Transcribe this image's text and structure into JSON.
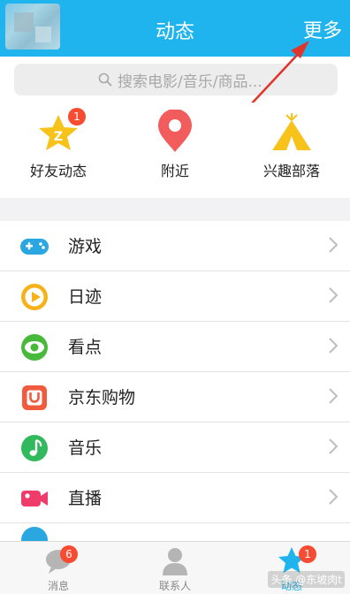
{
  "header": {
    "title": "动态",
    "more_label": "更多"
  },
  "search": {
    "placeholder": "搜索电影/音乐/商品..."
  },
  "shortcuts": [
    {
      "label": "好友动态",
      "icon": "qzone-star-icon",
      "badge": "1"
    },
    {
      "label": "附近",
      "icon": "location-pin-icon"
    },
    {
      "label": "兴趣部落",
      "icon": "tent-icon"
    }
  ],
  "list": [
    {
      "label": "游戏",
      "icon": "gamepad-icon"
    },
    {
      "label": "日迹",
      "icon": "play-circle-icon"
    },
    {
      "label": "看点",
      "icon": "eye-icon"
    },
    {
      "label": "京东购物",
      "icon": "jd-bag-icon"
    },
    {
      "label": "音乐",
      "icon": "music-note-icon"
    },
    {
      "label": "直播",
      "icon": "video-camera-icon"
    }
  ],
  "tabbar": {
    "messages": {
      "label": "消息",
      "badge": "6"
    },
    "contacts": {
      "label": "联系人"
    },
    "dynamic": {
      "label": "动态",
      "badge": "1"
    }
  },
  "watermark": "头条 @东坡肉t",
  "colors": {
    "header": "#1fb4ee",
    "badge": "#f74c31",
    "active_tab": "#1fb4ee"
  }
}
